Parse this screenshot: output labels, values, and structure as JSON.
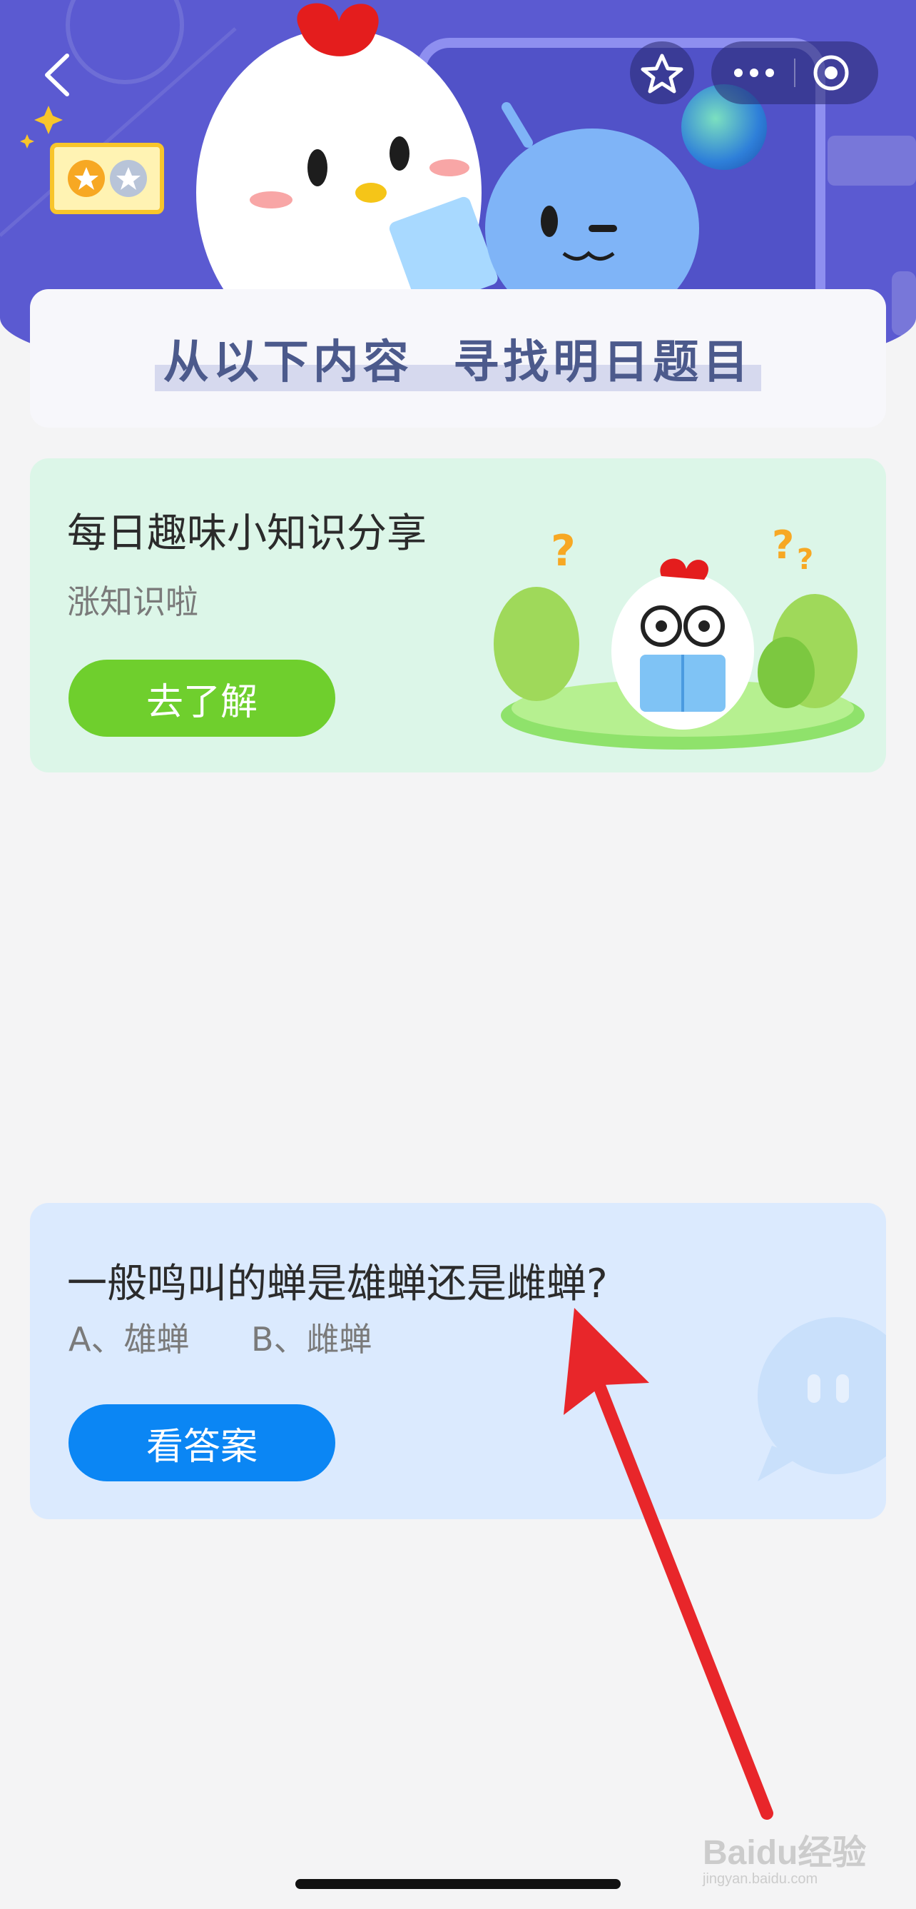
{
  "banner": {
    "title": "从以下内容  寻找明日题目"
  },
  "knowledge_card": {
    "title": "每日趣味小知识分享",
    "subtitle": "涨知识啦",
    "button_label": "去了解"
  },
  "question_card": {
    "question": "一般鸣叫的蝉是雄蝉还是雌蝉?",
    "option_a": "A、雄蝉",
    "option_b": "B、雌蝉",
    "button_label": "看答案"
  },
  "watermark": {
    "brand": "Baidu经验",
    "url": "jingyan.baidu.com"
  },
  "colors": {
    "header": "#5b5ad1",
    "knowledge_button": "#6fcf2d",
    "answer_button": "#0b86f4",
    "annotation_arrow": "#e8262a"
  },
  "icons": {
    "back": "chevron-left-icon",
    "favorite": "star-icon",
    "more": "more-dots-icon",
    "close": "target-circle-icon"
  }
}
